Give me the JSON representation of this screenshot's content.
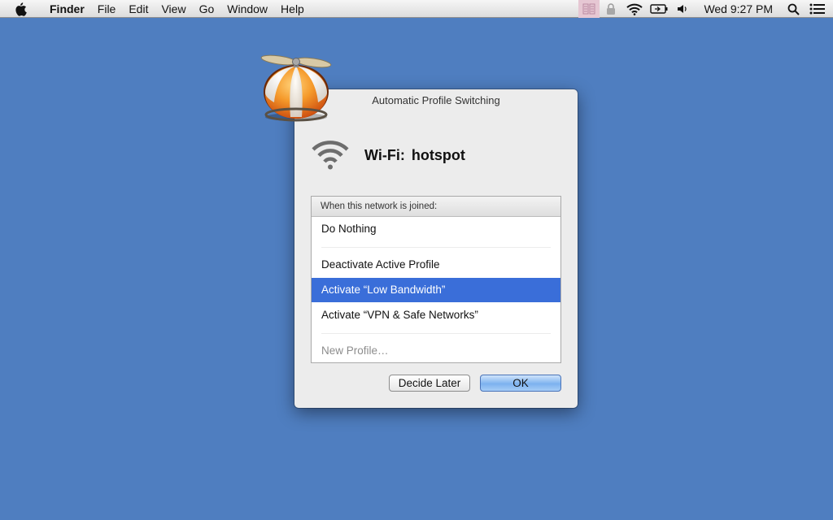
{
  "menubar": {
    "app_name": "Finder",
    "menus": [
      "File",
      "Edit",
      "View",
      "Go",
      "Window",
      "Help"
    ],
    "clock": "Wed 9:27 PM",
    "tray_icons": [
      "profile-switch-icon",
      "lock-icon",
      "wifi-icon",
      "battery-icon",
      "volume-icon",
      "spotlight-search-icon",
      "notification-list-icon"
    ]
  },
  "dialog": {
    "title": "Automatic Profile Switching",
    "network_label": "Wi-Fi:",
    "network_name": "hotspot",
    "list_header": "When this network is joined:",
    "options": [
      {
        "label": "Do Nothing",
        "selected": false
      },
      {
        "label": "Deactivate Active Profile",
        "selected": false
      },
      {
        "label": "Activate “Low Bandwidth”",
        "selected": true
      },
      {
        "label": "Activate “VPN & Safe Networks”",
        "selected": false
      },
      {
        "label": "New Profile…",
        "disabled": true
      }
    ],
    "buttons": {
      "later": "Decide Later",
      "ok": "OK"
    }
  },
  "colors": {
    "desktop": "#4f7ec0",
    "selection": "#3a6ed9",
    "app_icon_orange": "#f07c1e"
  }
}
